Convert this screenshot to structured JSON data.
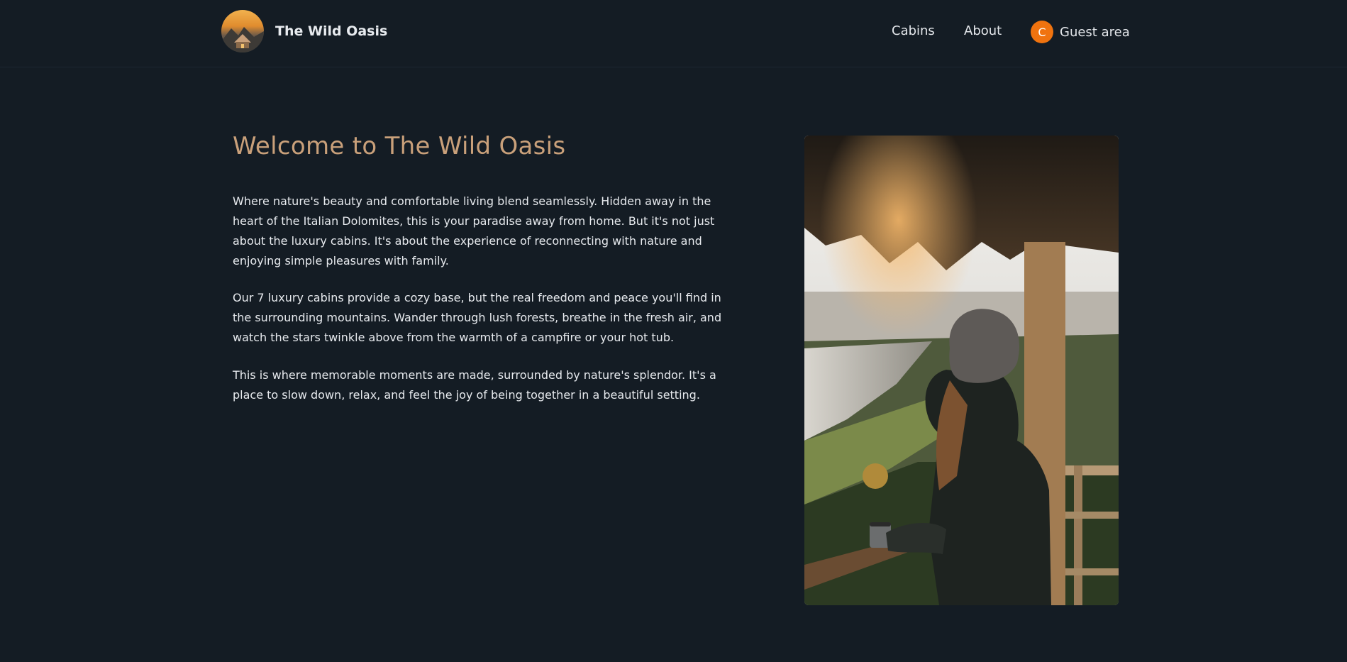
{
  "header": {
    "brand_name": "The Wild Oasis",
    "nav": {
      "cabins": "Cabins",
      "about": "About",
      "guest_avatar_initial": "C",
      "guest_area": "Guest area"
    }
  },
  "main": {
    "title": "Welcome to The Wild Oasis",
    "paragraphs": [
      "Where nature's beauty and comfortable living blend seamlessly. Hidden away in the heart of the Italian Dolomites, this is your paradise away from home. But it's not just about the luxury cabins. It's about the experience of reconnecting with nature and enjoying simple pleasures with family.",
      "Our 7 luxury cabins provide a cozy base, but the real freedom and peace you'll find in the surrounding mountains. Wander through lush forests, breathe in the fresh air, and watch the stars twinkle above from the warmth of a campfire or your hot tub.",
      "This is where memorable moments are made, surrounded by nature's splendor. It's a place to slow down, relax, and feel the joy of being together in a beautiful setting."
    ]
  },
  "colors": {
    "background": "#141c24",
    "accent": "#c9a07a",
    "avatar": "#f0730f",
    "text": "#e7eaee"
  }
}
